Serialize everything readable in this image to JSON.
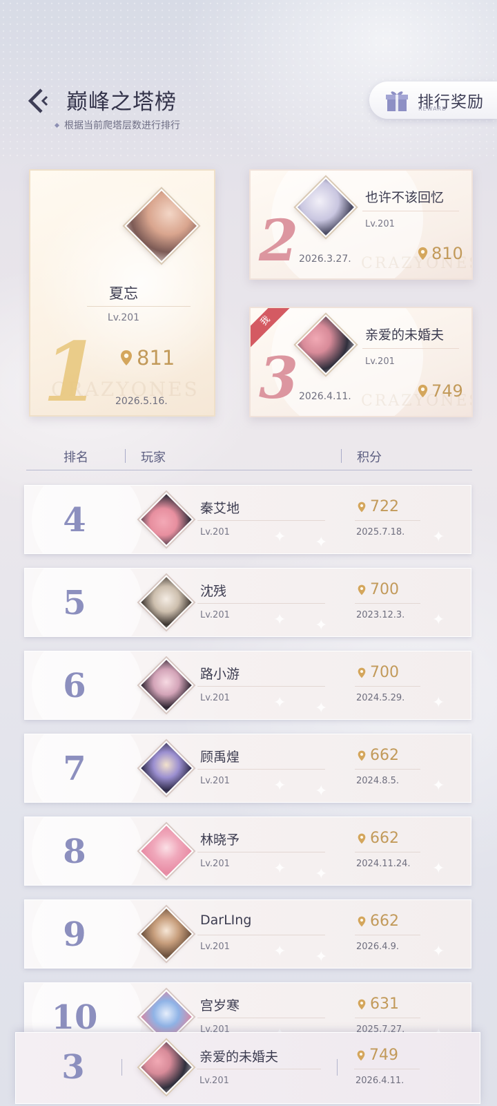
{
  "header": {
    "title": "巅峰之塔榜",
    "subtitle": "根据当前爬塔层数进行排行",
    "reward_button": {
      "label": "排行奖励",
      "sub_label": "REWARD"
    }
  },
  "podium": [
    {
      "rank": "1",
      "name": "夏忘",
      "level": "Lv.201",
      "score": "811",
      "date": "2026.5.16.",
      "watermark": "CRAZYONES"
    },
    {
      "rank": "2",
      "name": "也许不该回忆",
      "level": "Lv.201",
      "score": "810",
      "date": "2026.3.27.",
      "watermark": "CRAZYONES"
    },
    {
      "rank": "3",
      "name": "亲爱的未婚夫",
      "level": "Lv.201",
      "score": "749",
      "date": "2026.4.11.",
      "me_badge": "我",
      "watermark": "CRAZYONES"
    }
  ],
  "table_headers": {
    "rank": "排名",
    "player": "玩家",
    "score": "积分"
  },
  "rows": [
    {
      "rank": "4",
      "name": "秦艾地",
      "level": "Lv.201",
      "score": "722",
      "date": "2025.7.18."
    },
    {
      "rank": "5",
      "name": "沈残",
      "level": "Lv.201",
      "score": "700",
      "date": "2023.12.3."
    },
    {
      "rank": "6",
      "name": "路小游",
      "level": "Lv.201",
      "score": "700",
      "date": "2024.5.29."
    },
    {
      "rank": "7",
      "name": "顾禹煌",
      "level": "Lv.201",
      "score": "662",
      "date": "2024.8.5."
    },
    {
      "rank": "8",
      "name": "林晓予",
      "level": "Lv.201",
      "score": "662",
      "date": "2024.11.24."
    },
    {
      "rank": "9",
      "name": "DarLIng",
      "level": "Lv.201",
      "score": "662",
      "date": "2026.4.9."
    },
    {
      "rank": "10",
      "name": "宫岁寒",
      "level": "Lv.201",
      "score": "631",
      "date": "2025.7.27."
    }
  ],
  "my_rank": {
    "rank": "3",
    "name": "亲爱的未婚夫",
    "level": "Lv.201",
    "score": "749",
    "date": "2026.4.11."
  },
  "colors": {
    "gold_score": "#c29a5a",
    "rank_numeral": "#8c8fbe",
    "rank1_gold": "#e8c67a",
    "rank_pink": "#d98c97",
    "me_ribbon": "#d45a62"
  },
  "icons": {
    "back": "back-arrow-icon",
    "reward": "gift-icon",
    "score": "location-pin-icon"
  }
}
